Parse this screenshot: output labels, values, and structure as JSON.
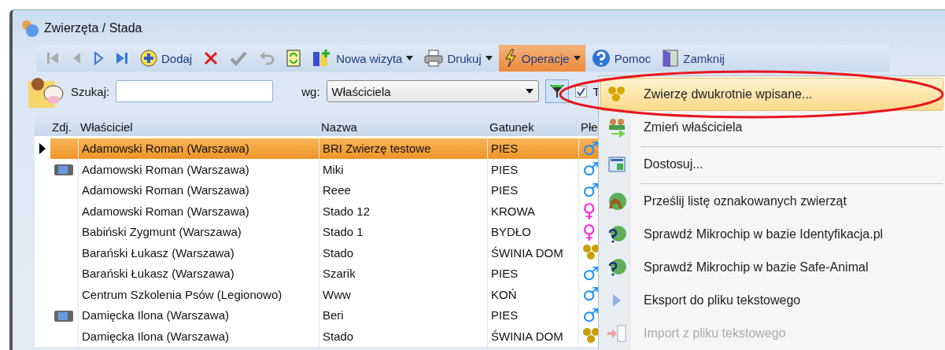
{
  "window": {
    "title": "Zwierzęta / Stada"
  },
  "toolbar": [
    {
      "kind": "first",
      "disabled": true,
      "open": false
    },
    {
      "kind": "prev",
      "disabled": true,
      "open": false
    },
    {
      "kind": "next",
      "disabled": false,
      "open": false
    },
    {
      "kind": "last",
      "disabled": false,
      "open": false
    },
    {
      "kind": "add",
      "label": "Dodaj",
      "disabled": false,
      "open": false
    },
    {
      "kind": "delete",
      "disabled": false,
      "open": false
    },
    {
      "kind": "confirm",
      "disabled": true,
      "open": false
    },
    {
      "kind": "undo",
      "disabled": true,
      "open": false
    },
    {
      "kind": "refresh",
      "disabled": false,
      "open": false
    },
    {
      "kind": "visit",
      "label": "Nowa wizyta",
      "dropdown": true,
      "disabled": false,
      "open": false
    },
    {
      "kind": "print",
      "label": "Drukuj",
      "dropdown": true,
      "disabled": false,
      "open": false
    },
    {
      "kind": "operations",
      "label": "Operacje",
      "dropdown": true,
      "disabled": false,
      "open": true
    },
    {
      "kind": "help",
      "label": "Pomoc",
      "disabled": false,
      "open": false
    },
    {
      "kind": "close",
      "label": "Zamknij",
      "disabled": false,
      "open": false
    }
  ],
  "search": {
    "label": "Szukaj:",
    "by_label": "wg:",
    "by_value": "Właściciela",
    "filter": {
      "checked": true,
      "label": "T"
    }
  },
  "table": {
    "columns": [
      "Zdj.",
      "Właściciel",
      "Nazwa",
      "Gatunek",
      "Płe"
    ],
    "rows": [
      {
        "selected": true,
        "photo": false,
        "owner": "Adamowski Roman (Warszawa)",
        "name": "BRI Zwierzę testowe",
        "species": "PIES",
        "sex": {
          "kind": "male",
          "symbol": "♂"
        }
      },
      {
        "selected": false,
        "photo": true,
        "owner": "Adamowski Roman (Warszawa)",
        "name": "Miki",
        "species": "PIES",
        "sex": {
          "kind": "male",
          "symbol": "♂"
        }
      },
      {
        "selected": false,
        "photo": false,
        "owner": "Adamowski Roman (Warszawa)",
        "name": "Reee",
        "species": "PIES",
        "sex": {
          "kind": "male",
          "symbol": "♂"
        }
      },
      {
        "selected": false,
        "photo": false,
        "owner": "Adamowski Roman (Warszawa)",
        "name": "Stado 12",
        "species": "KROWA",
        "sex": {
          "kind": "female",
          "symbol": "♀"
        }
      },
      {
        "selected": false,
        "photo": false,
        "owner": "Babiński Zygmunt (Warszawa)",
        "name": "Stado 1",
        "species": "BYDŁO",
        "sex": {
          "kind": "female",
          "symbol": "♀"
        }
      },
      {
        "selected": false,
        "photo": false,
        "owner": "Barański Łukasz (Warszawa)",
        "name": "Stado",
        "species": "ŚWINIA DOM",
        "sex": {
          "kind": "herd"
        }
      },
      {
        "selected": false,
        "photo": false,
        "owner": "Barański Łukasz (Warszawa)",
        "name": "Szarik",
        "species": "PIES",
        "sex": {
          "kind": "male",
          "symbol": "♂"
        }
      },
      {
        "selected": false,
        "photo": false,
        "owner": "Centrum Szkolenia Psów (Legionowo)",
        "name": "Www",
        "species": "KOŃ",
        "sex": {
          "kind": "male",
          "symbol": "♂"
        }
      },
      {
        "selected": false,
        "photo": true,
        "owner": "Damięcka Ilona (Warszawa)",
        "name": "Beri",
        "species": "PIES",
        "sex": {
          "kind": "male",
          "symbol": "♂"
        }
      },
      {
        "selected": false,
        "photo": false,
        "owner": "Damięcka Ilona (Warszawa)",
        "name": "Stado",
        "species": "ŚWINIA DOM",
        "sex": {
          "kind": "herd"
        }
      }
    ]
  },
  "menu": [
    {
      "kind": "duplicates",
      "label": "Zwierzę dwukrotnie wpisane...",
      "selected": true,
      "disabled": false,
      "separator_after": false
    },
    {
      "kind": "owner",
      "label": "Zmień właściciela",
      "selected": false,
      "disabled": false,
      "separator_after": true
    },
    {
      "kind": "customize",
      "label": "Dostosuj...",
      "selected": false,
      "disabled": false,
      "separator_after": true
    },
    {
      "kind": "send",
      "label": "Prześlij listę oznakowanych zwierząt",
      "selected": false,
      "disabled": false,
      "separator_after": false
    },
    {
      "kind": "check",
      "label": "Sprawdź Mikrochip w bazie Identyfikacja.pl",
      "selected": false,
      "disabled": false,
      "separator_after": false
    },
    {
      "kind": "check",
      "label": "Sprawdź Mikrochip w bazie Safe-Animal",
      "selected": false,
      "disabled": false,
      "separator_after": false
    },
    {
      "kind": "export",
      "label": "Eksport do pliku tekstowego",
      "selected": false,
      "disabled": false,
      "separator_after": false
    },
    {
      "kind": "import",
      "label": "Import z pliku tekstowego",
      "selected": false,
      "disabled": true,
      "separator_after": false
    }
  ]
}
